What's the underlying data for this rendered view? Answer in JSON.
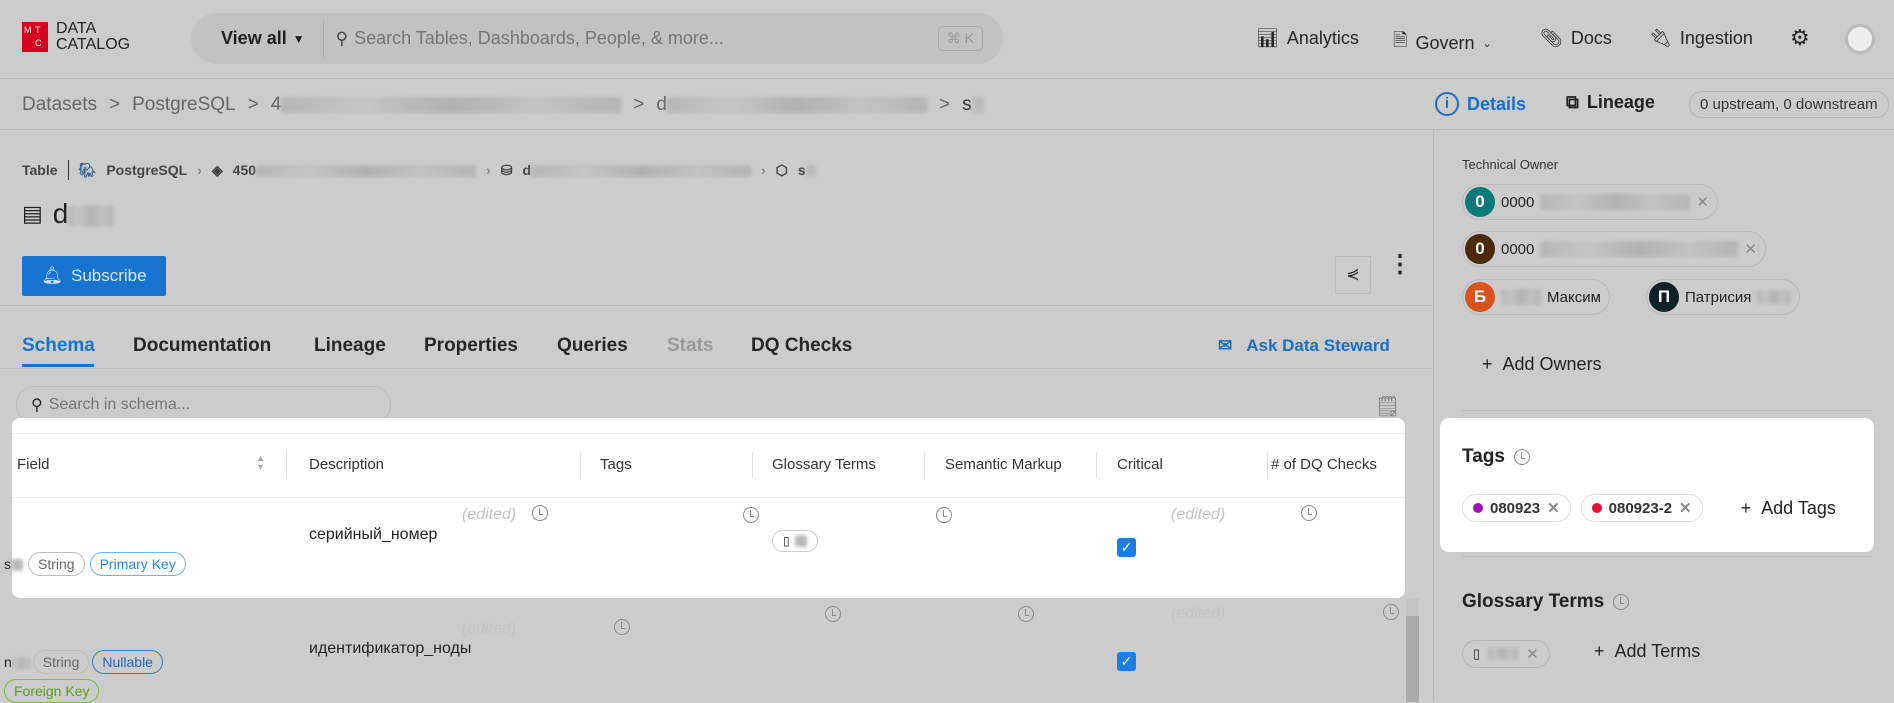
{
  "nav": {
    "logo_letters": [
      "М",
      "Т",
      "С"
    ],
    "logo_line1": "DATA",
    "logo_line2": "CATALOG",
    "view_all": "View all",
    "search_placeholder": "Search Tables, Dashboards, People, & more...",
    "shortcut": "⌘ K",
    "items": [
      {
        "label": "Analytics"
      },
      {
        "label": "Govern"
      },
      {
        "label": "Docs"
      },
      {
        "label": "Ingestion"
      }
    ]
  },
  "breadcrumb": {
    "items": [
      "Datasets",
      "PostgreSQL",
      "4",
      "d",
      "s"
    ],
    "sep": ">"
  },
  "view_toggle": {
    "details": "Details",
    "lineage": "Lineage",
    "lineage_count": "0 upstream, 0 downstream"
  },
  "entity": {
    "type": "Table",
    "platform": "PostgreSQL",
    "container_prefix": "450",
    "database_prefix": "d",
    "schema_prefix": "s",
    "title_prefix": "d",
    "subscribe": "Subscribe"
  },
  "tabs": [
    "Schema",
    "Documentation",
    "Lineage",
    "Properties",
    "Queries",
    "Stats",
    "DQ Checks"
  ],
  "ask_steward": "Ask Data Steward",
  "schema": {
    "search_placeholder": "Search in schema...",
    "columns": [
      "Field",
      "Description",
      "Tags",
      "Glossary Terms",
      "Semantic Markup",
      "Critical",
      "# of DQ Checks"
    ],
    "rows": [
      {
        "field_prefix": "s",
        "type": "String",
        "badges": [
          "Primary Key"
        ],
        "description": "серийный_номер",
        "edited": "(edited)",
        "critical": true
      },
      {
        "field_prefix": "n",
        "type": "String",
        "badges": [
          "Nullable",
          "Foreign Key"
        ],
        "description": "идентификатор_ноды",
        "edited": "(edited)",
        "critical": true
      }
    ]
  },
  "sidebar": {
    "owner_label": "Technical Owner",
    "owners": [
      {
        "initial": "0",
        "name": "0000",
        "color": "#0b7a78"
      },
      {
        "initial": "0",
        "name": "0000",
        "color": "#4a2a0a"
      },
      {
        "initial": "Б",
        "name": "Максим",
        "color": "#d9531e"
      },
      {
        "initial": "П",
        "name": "Патрисия",
        "color": "#0f2228"
      }
    ],
    "add_owners": "Add Owners",
    "tags_title": "Tags",
    "tags": [
      {
        "label": "080923",
        "color": "#a010b8"
      },
      {
        "label": "080923-2",
        "color": "#e8112d"
      }
    ],
    "add_tags": "Add Tags",
    "glossary_title": "Glossary Terms",
    "add_terms": "Add Terms"
  }
}
